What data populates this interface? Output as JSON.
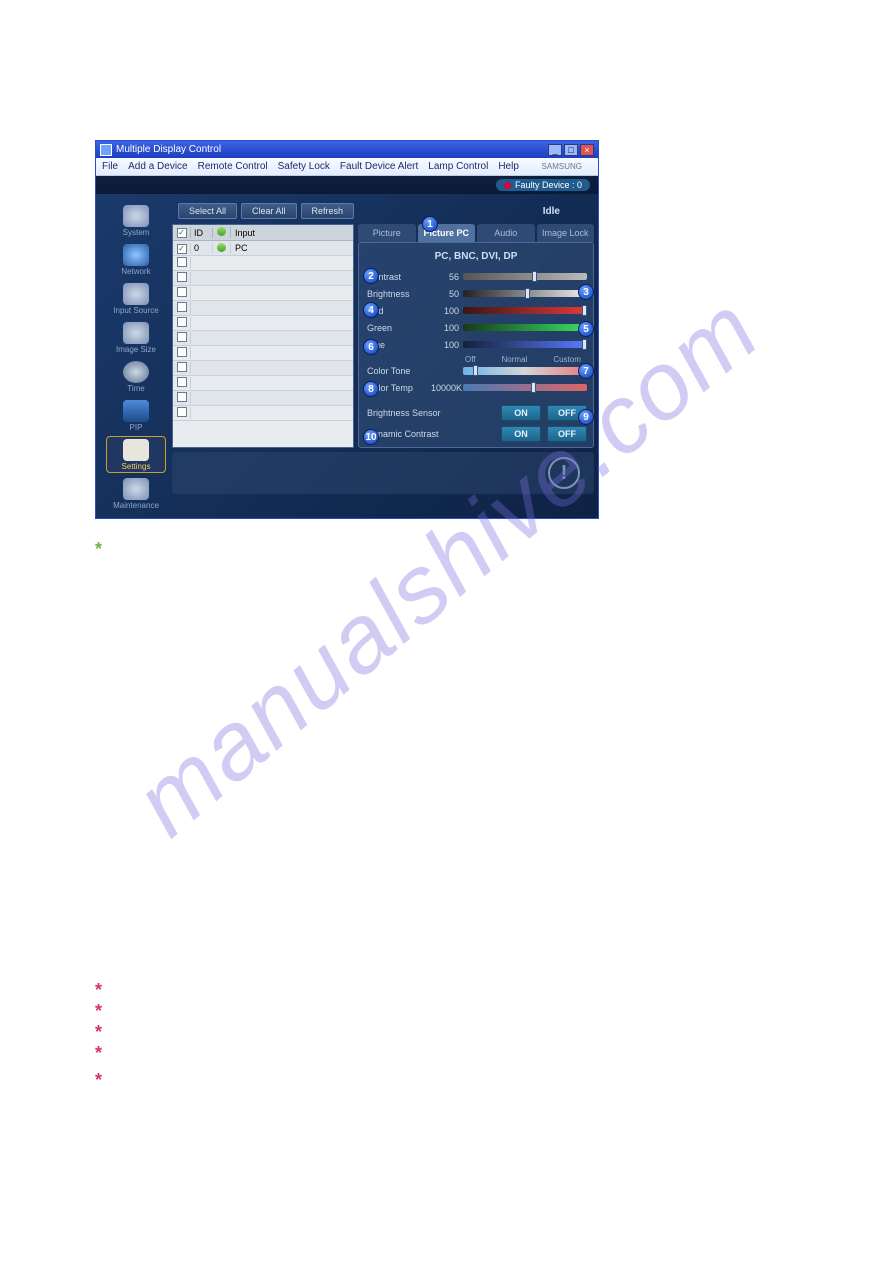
{
  "watermark": "manualshive.com",
  "app": {
    "title": "Multiple Display Control",
    "menu": [
      "File",
      "Add a Device",
      "Remote Control",
      "Safety Lock",
      "Fault Device Alert",
      "Lamp Control",
      "Help"
    ],
    "faulty": "Faulty Device : 0",
    "toolbar": {
      "select_all": "Select All",
      "clear_all": "Clear All",
      "refresh": "Refresh",
      "idle": "Idle"
    },
    "sidebar": [
      "System",
      "Network",
      "Input Source",
      "Image Size",
      "Time",
      "PIP",
      "Settings",
      "Maintenance"
    ],
    "grid": {
      "headers": {
        "id": "ID",
        "input": "Input"
      },
      "row": {
        "id": "0",
        "input": "PC"
      }
    },
    "tabs": [
      "Picture",
      "Picture PC",
      "Audio",
      "Image Lock"
    ],
    "panel": {
      "header": "PC, BNC, DVI, DP",
      "rows": [
        {
          "label": "Contrast",
          "value": "56"
        },
        {
          "label": "Brightness",
          "value": "50"
        },
        {
          "label": "Red",
          "value": "100"
        },
        {
          "label": "Green",
          "value": "100"
        },
        {
          "label": "Blue",
          "value": "100"
        },
        {
          "label": "Color Tone",
          "value": ""
        },
        {
          "label": "Color Temp",
          "value": "10000K"
        }
      ],
      "tone_labels": [
        "Off",
        "Normal",
        "Custom"
      ],
      "brightness_sensor": "Brightness Sensor",
      "dynamic_contrast": "Dynamic Contrast",
      "on": "ON",
      "off": "OFF"
    }
  },
  "badges": [
    "1",
    "2",
    "3",
    "4",
    "5",
    "6",
    "7",
    "8",
    "9",
    "10"
  ]
}
